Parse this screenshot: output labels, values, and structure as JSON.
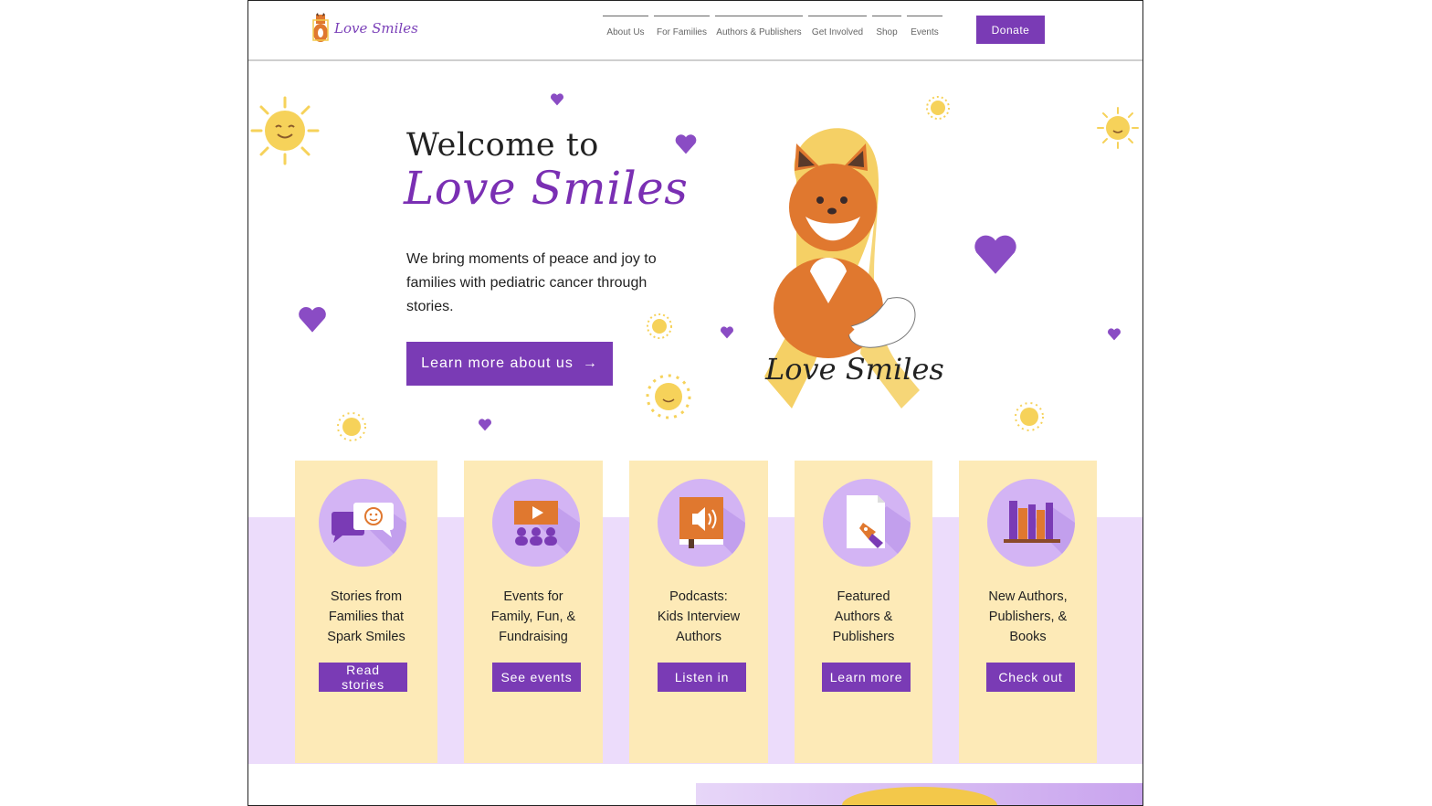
{
  "header": {
    "logo_text": "Love Smiles",
    "nav": [
      "About Us",
      "For Families",
      "Authors & Publishers",
      "Get Involved",
      "Shop",
      "Events"
    ],
    "donate_label": "Donate"
  },
  "hero": {
    "welcome": "Welcome to",
    "brand": "Love Smiles",
    "tagline": "We bring moments of peace and joy to families with pediatric cancer through stories.",
    "cta_label": "Learn more about us",
    "illustration_text": "Love Smiles"
  },
  "cards": [
    {
      "title": "Stories from\nFamilies that\nSpark Smiles",
      "button": "Read stories",
      "icon": "chat-bubbles-icon"
    },
    {
      "title": "Events for\nFamily, Fun, &\nFundraising",
      "button": "See events",
      "icon": "video-audience-icon"
    },
    {
      "title": "Podcasts:\nKids Interview\nAuthors",
      "button": "Listen in",
      "icon": "audio-book-icon"
    },
    {
      "title": "Featured\nAuthors &\nPublishers",
      "button": "Learn more",
      "icon": "pen-paper-icon"
    },
    {
      "title": "New Authors,\nPublishers, &\nBooks",
      "button": "Check out",
      "icon": "bookshelf-icon"
    }
  ],
  "colors": {
    "purple": "#7a3bb5",
    "card_yellow": "#fdeab7",
    "band_lavender": "#ecdcfb",
    "sun": "#f6d25a",
    "fox": "#e0782f"
  }
}
